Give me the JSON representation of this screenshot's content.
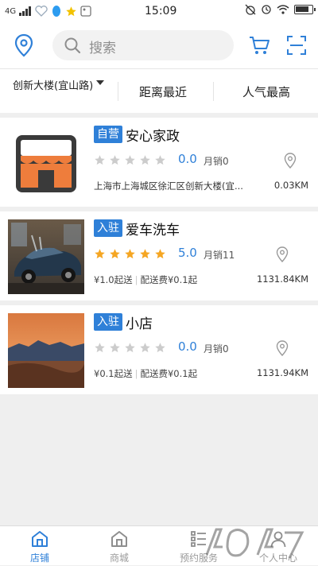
{
  "status_bar": {
    "network": "4G",
    "time": "15:09"
  },
  "header": {
    "search_placeholder": "搜索"
  },
  "filter": {
    "location": "创新大楼(宜山路)",
    "distance": "距离最近",
    "popularity": "人气最高"
  },
  "stores": [
    {
      "tag": "自营",
      "name": "安心家政",
      "rating": "0.0",
      "stars_filled": 0,
      "sales": "月销0",
      "address": "上海市上海城区徐汇区创新大楼(宜...",
      "distance": "0.03KM"
    },
    {
      "tag": "入驻",
      "name": "爱车洗车",
      "rating": "5.0",
      "stars_filled": 5,
      "sales": "月销11",
      "min_order": "¥1.0起送",
      "delivery_fee": "配送费¥0.1起",
      "distance": "1131.84KM"
    },
    {
      "tag": "入驻",
      "name": "小店",
      "rating": "0.0",
      "stars_filled": 0,
      "sales": "月销0",
      "min_order": "¥0.1起送",
      "delivery_fee": "配送费¥0.1起",
      "distance": "1131.94KM"
    }
  ],
  "bottom_nav": [
    {
      "label": "店铺",
      "icon": "store-icon",
      "active": true
    },
    {
      "label": "商城",
      "icon": "mall-icon",
      "active": false
    },
    {
      "label": "预约服务",
      "icon": "appointment-icon",
      "active": false
    },
    {
      "label": "个人中心",
      "icon": "profile-icon",
      "active": false
    }
  ],
  "colors": {
    "accent": "#2f80d8",
    "star_filled": "#f5a623",
    "star_empty": "#cccccc"
  }
}
